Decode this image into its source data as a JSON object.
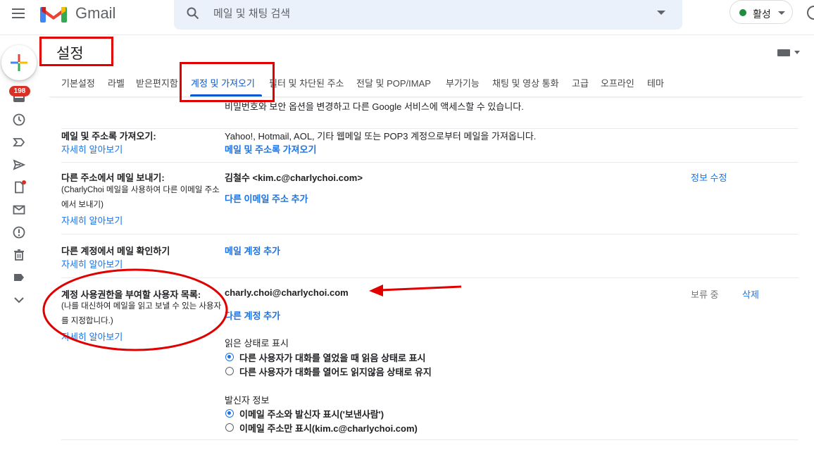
{
  "app": {
    "name": "Gmail"
  },
  "search": {
    "placeholder": "메일 및 채팅 검색"
  },
  "status": {
    "label": "활성"
  },
  "rail": {
    "badge_count": "198"
  },
  "settings": {
    "title": "설정"
  },
  "tabs": [
    {
      "label": "기본설정"
    },
    {
      "label": "라벨"
    },
    {
      "label": "받은편지함"
    },
    {
      "label": "계정 및 가져오기"
    },
    {
      "label": "필터 및 차단된 주소"
    },
    {
      "label": "전달 및 POP/IMAP"
    },
    {
      "label": "부가기능"
    },
    {
      "label": "채팅 및 영상 통화"
    },
    {
      "label": "고급"
    },
    {
      "label": "오프라인"
    },
    {
      "label": "테마"
    }
  ],
  "sections": {
    "top_partial": {
      "text": "비밀번호와 보안 옵션을 변경하고 다른 Google 서비스에 액세스할 수 있습니다."
    },
    "import": {
      "title": "메일 및 주소록 가져오기:",
      "learn_more": "자세히 알아보기",
      "text": "Yahoo!, Hotmail, AOL, 기타 웹메일 또는 POP3 계정으로부터 메일을 가져옵니다.",
      "link": "메일 및 주소록 가져오기"
    },
    "send_as": {
      "title": "다른 주소에서 메일 보내기:",
      "desc": "(CharlyChoi 메일을 사용하여 다른 이메일 주소에서 보내기)",
      "learn_more": "자세히 알아보기",
      "address": "김철수 <kim.c@charlychoi.com>",
      "edit_link": "정보 수정",
      "add_link": "다른 이메일 주소 추가"
    },
    "check_mail": {
      "title": "다른 계정에서 메일 확인하기",
      "learn_more": "자세히 알아보기",
      "add_link": "메일 계정 추가"
    },
    "delegate": {
      "title": "계정 사용권한을 부여할 사용자 목록:",
      "desc": "(나를 대신하여 메일을 읽고 보낼 수 있는 사용자를 지정합니다.)",
      "learn_more": "자세히 알아보기",
      "email": "charly.choi@charlychoi.com",
      "status": "보류 중",
      "delete_link": "삭제",
      "add_link": "다른 계정 추가",
      "read_status_heading": "읽은 상태로 표시",
      "read_options": [
        {
          "label": "다른 사용자가 대화를 열었을 때 읽음 상태로 표시",
          "selected": true
        },
        {
          "label": "다른 사용자가 대화를 열어도 읽지않음 상태로 유지",
          "selected": false
        }
      ],
      "sender_heading": "발신자 정보",
      "sender_options": [
        {
          "label": "이메일 주소와 발신자 표시('보낸사람')",
          "selected": true
        },
        {
          "label": "이메일 주소만 표시(kim.c@charlychoi.com)",
          "selected": false
        }
      ]
    }
  },
  "colors": {
    "accent": "#0b57d0",
    "link": "#1a73e8",
    "annotation": "#e00000"
  }
}
